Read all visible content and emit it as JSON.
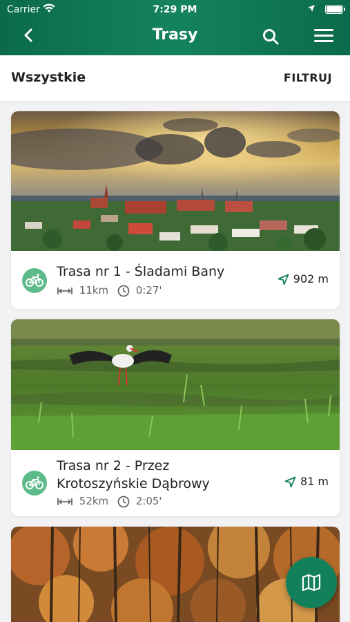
{
  "status_bar": {
    "carrier": "Carrier",
    "time": "7:29 PM"
  },
  "header": {
    "title": "Trasy"
  },
  "filter_bar": {
    "all_label": "Wszystkie",
    "filter_label": "FILTRUJ"
  },
  "routes": [
    {
      "name": "Trasa nr 1 - Śladami Bany",
      "length": "11km",
      "duration": "0:27'",
      "distance": "902 m",
      "image": "town-sunset-photo"
    },
    {
      "name_line1": "Trasa nr 2 - Przez",
      "name_line2": "Krotoszyńskie Dąbrowy",
      "length": "52km",
      "duration": "2:05'",
      "distance": "81 m",
      "image": "stork-field-photo"
    },
    {
      "image": "autumn-forest-photo"
    }
  ],
  "colors": {
    "header_green": "#13805c",
    "accent_green": "#5dbb8a"
  }
}
